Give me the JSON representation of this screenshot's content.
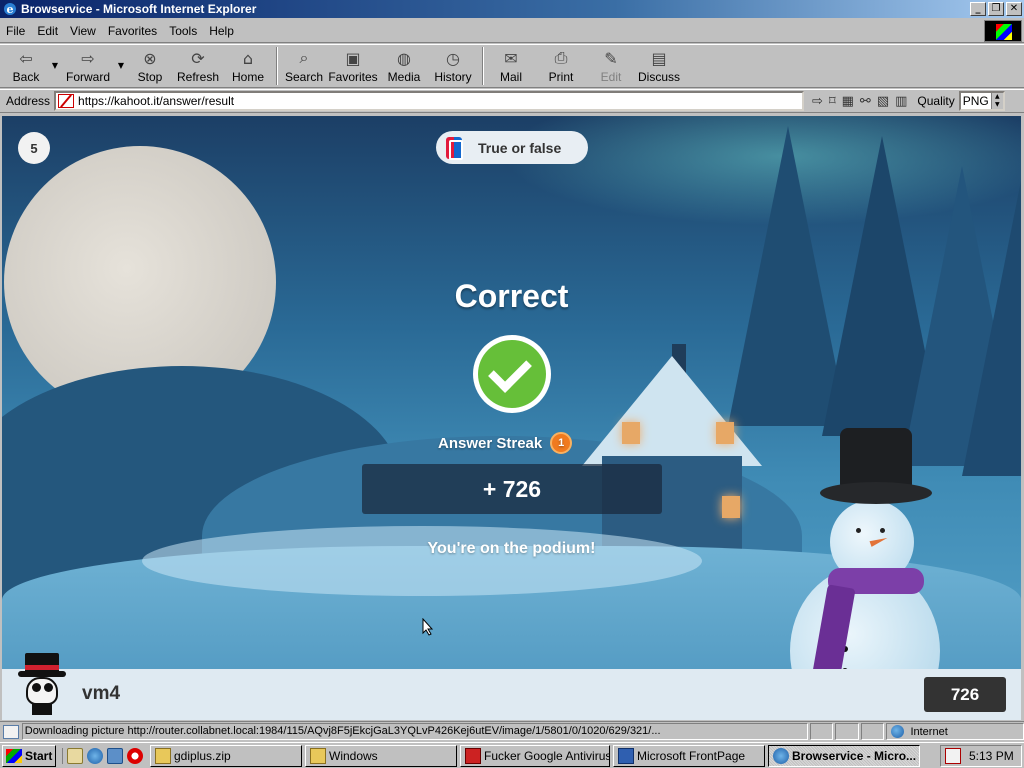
{
  "window": {
    "title": "Browservice - Microsoft Internet Explorer",
    "buttons": {
      "minimize": "_",
      "maximize": "❐",
      "close": "✕"
    }
  },
  "menu": {
    "items": [
      {
        "label": "File"
      },
      {
        "label": "Edit"
      },
      {
        "label": "View"
      },
      {
        "label": "Favorites"
      },
      {
        "label": "Tools"
      },
      {
        "label": "Help"
      }
    ]
  },
  "toolbar": {
    "back": "Back",
    "forward": "Forward",
    "stop": "Stop",
    "refresh": "Refresh",
    "home": "Home",
    "search": "Search",
    "favorites": "Favorites",
    "media": "Media",
    "history": "History",
    "mail": "Mail",
    "print": "Print",
    "edit": "Edit",
    "discuss": "Discuss"
  },
  "address": {
    "label": "Address",
    "url": "https://kahoot.it/answer/result",
    "quality_label": "Quality",
    "quality_value": "PNG"
  },
  "kahoot": {
    "question_number": "5",
    "question_type": "True or false",
    "result": "Correct",
    "streak_label": "Answer Streak",
    "streak_count": "1",
    "points": "+ 726",
    "podium": "You're on the podium!",
    "player_name": "vm4",
    "score": "726"
  },
  "status": {
    "text": "Downloading picture http://router.collabnet.local:1984/115/AQvj8F5jEkcjGaL3YQLvP426Kej6utEV/image/1/5801/0/1020/629/321/...",
    "zone": "Internet"
  },
  "taskbar": {
    "start": "Start",
    "tasks": [
      {
        "label": "gdiplus.zip"
      },
      {
        "label": "Windows"
      },
      {
        "label": "Fucker Google Antivirus ..."
      },
      {
        "label": "Microsoft FrontPage"
      },
      {
        "label": "Browservice - Micro..."
      }
    ],
    "clock": "5:13 PM"
  },
  "colors": {
    "kahoot_correct": "#66bf39",
    "kahoot_streak": "#f07a1f",
    "titlebar_start": "#0a246a",
    "titlebar_end": "#a6caf0"
  }
}
